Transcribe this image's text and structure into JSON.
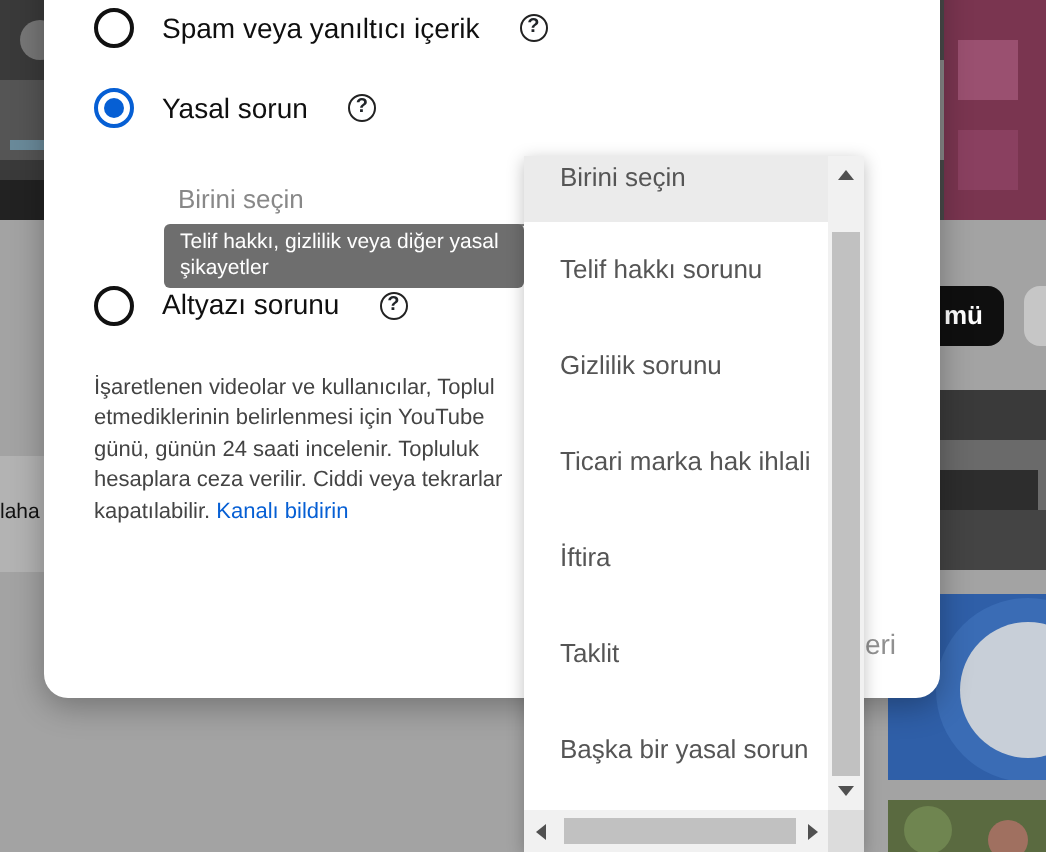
{
  "background": {
    "chips": [
      {
        "label": "laha",
        "kind": "light"
      },
      {
        "label": "mü",
        "kind": "dark"
      }
    ]
  },
  "dialog": {
    "options": [
      {
        "label": "Spam veya yanıltıcı içerik",
        "help": "?",
        "selected": false
      },
      {
        "label": "Yasal sorun",
        "help": "?",
        "selected": true,
        "select": {
          "placeholder": "Birini seçin"
        },
        "tooltip": "Telif hakkı, gizlilik veya diğer yasal şikayetler"
      },
      {
        "label": "Altyazı sorunu",
        "help": "?",
        "selected": false
      }
    ],
    "notice": {
      "lines": [
        "İşaretlenen videolar ve kullanıcılar, Toplul",
        "etmediklerinin belirlenmesi için YouTube",
        "günü, günün 24 saati incelenir. Topluluk",
        "hesaplara ceza verilir. Ciddi veya tekrarlar",
        "kapatılabilir."
      ],
      "link": "Kanalı bildirin"
    },
    "next_button": "eri"
  },
  "dropdown": {
    "items": [
      {
        "label": "Birini seçin",
        "selected": true
      },
      {
        "label": "Telif hakkı sorunu",
        "selected": false
      },
      {
        "label": "Gizlilik sorunu",
        "selected": false
      },
      {
        "label": "Ticari marka hak ihlali",
        "selected": false
      },
      {
        "label": "İftira",
        "selected": false
      },
      {
        "label": "Taklit",
        "selected": false
      },
      {
        "label": "Başka bir yasal sorun",
        "selected": false
      }
    ]
  }
}
